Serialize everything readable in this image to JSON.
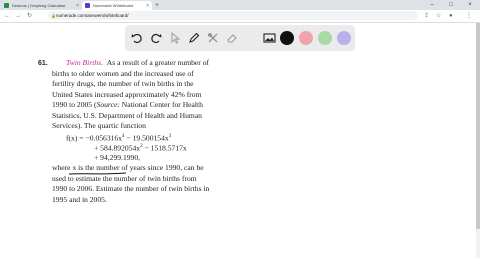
{
  "tabs": [
    {
      "label": "Desmos | Graphing Calculator",
      "active": false,
      "favicon_color": "#2f8e3b"
    },
    {
      "label": "Numerade Whiteboard",
      "active": true,
      "favicon_color": "#5b3cc4"
    }
  ],
  "address": {
    "url": "numerade.com/answers/whiteboard/"
  },
  "toolbar": {
    "tools": [
      "undo-icon",
      "redo-icon",
      "select-icon",
      "pen-icon",
      "tools-icon",
      "eraser-icon",
      "image-icon"
    ],
    "colors": [
      "#111111",
      "#f0a3aa",
      "#a9d9a5",
      "#b9b0ee"
    ]
  },
  "problem": {
    "number": "61.",
    "title": "Twin Births.",
    "lines": [
      "As a result of a greater number of",
      "births to older women and the increased use of",
      "fertility drugs, the number of twin births in the",
      "United States increased approximately 42% from",
      "1990 to 2005 (",
      "Source:",
      " National Center for Health",
      "Statistics, U.S. Department of Health and Human",
      "Services). The quartic function",
      "f(x) = −0.056316x",
      "4",
      " − 19.500154x",
      "3",
      "+ 584.892054x",
      "2",
      " − 1518.5717x",
      "+ 94,299.1990,",
      "where x is the number of years since 1990, can be",
      "used to estimate the number of twin births from",
      "1990 to 2006. Estimate the number of twin births in",
      "1995 and in 2005."
    ]
  }
}
